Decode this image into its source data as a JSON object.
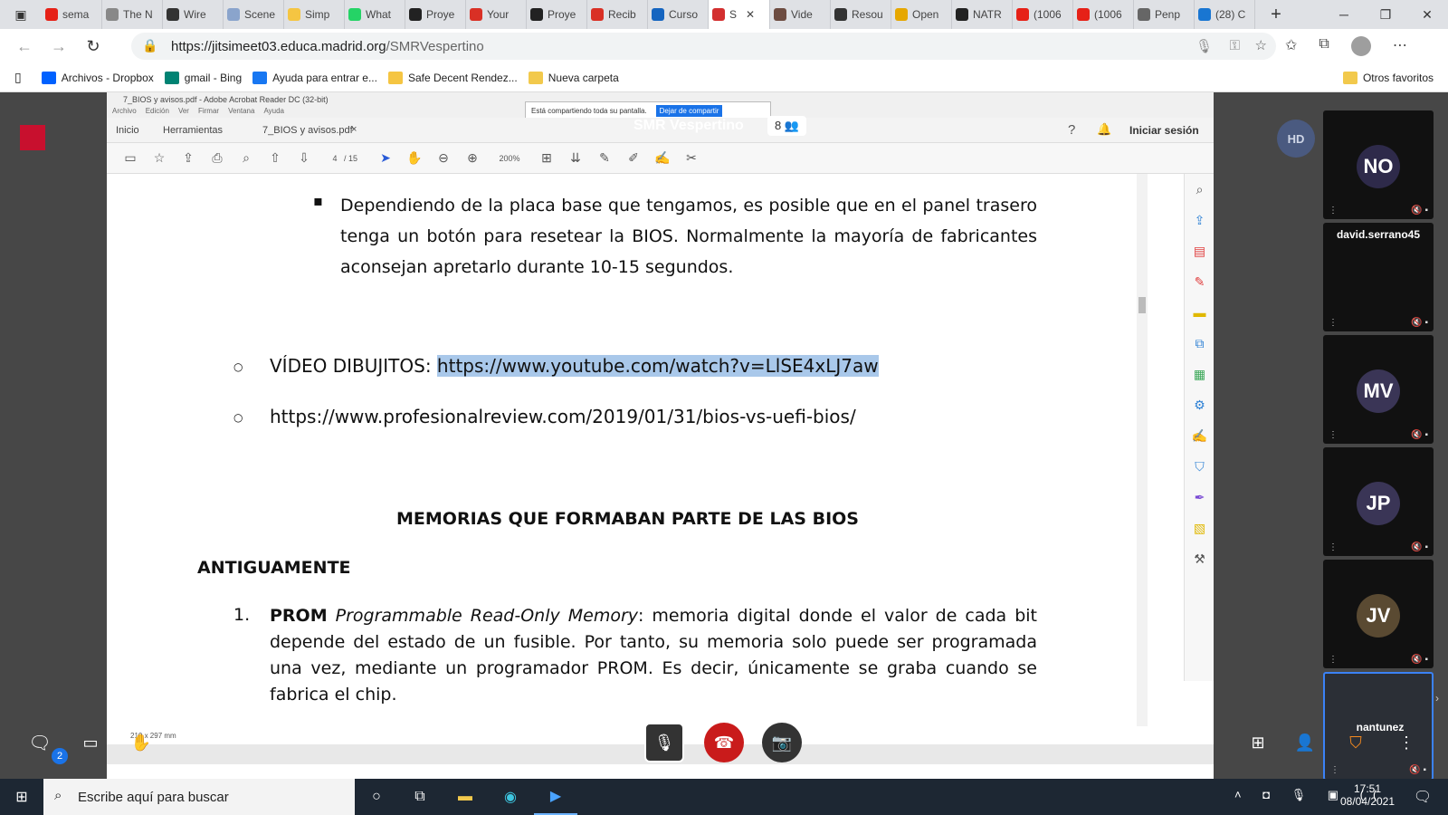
{
  "browser": {
    "tabs": [
      {
        "title": "sema",
        "color": "#e62117"
      },
      {
        "title": "The N",
        "color": "#888888"
      },
      {
        "title": "Wire",
        "color": "#333333"
      },
      {
        "title": "Scene",
        "color": "#8aa4cc"
      },
      {
        "title": "Simp",
        "color": "#f5c542"
      },
      {
        "title": "What",
        "color": "#25d366"
      },
      {
        "title": "Proye",
        "color": "#222222"
      },
      {
        "title": "Your",
        "color": "#d93025"
      },
      {
        "title": "Proye",
        "color": "#222222"
      },
      {
        "title": "Recib",
        "color": "#d93025"
      },
      {
        "title": "Curso",
        "color": "#1565c0"
      },
      {
        "title": "S",
        "color": "#d32f2f",
        "active": true
      },
      {
        "title": "Vide",
        "color": "#6d4c41"
      },
      {
        "title": "Resou",
        "color": "#333333"
      },
      {
        "title": "Open",
        "color": "#e6a700"
      },
      {
        "title": "NATR",
        "color": "#222222"
      },
      {
        "title": "(1006",
        "color": "#e62117"
      },
      {
        "title": "(1006",
        "color": "#e62117"
      },
      {
        "title": "Penp",
        "color": "#666666"
      },
      {
        "title": "(28) C",
        "color": "#1976d2"
      }
    ],
    "url_host": "https://jitsimeet03.educa.madrid.org",
    "url_path": "/SMRVespertino",
    "bookmarks": [
      {
        "label": "Archivos - Dropbox",
        "color": "#0061ff"
      },
      {
        "label": "gmail - Bing",
        "color": "#008373"
      },
      {
        "label": "Ayuda para entrar e...",
        "color": "#1877f2"
      },
      {
        "label": "Safe Decent Rendez...",
        "color": "#f5c542"
      },
      {
        "label": "Nueva carpeta",
        "color": "#f2c94c"
      }
    ],
    "other_favorites": "Otros favoritos"
  },
  "acrobat": {
    "window_title": "7_BIOS y avisos.pdf - Adobe Acrobat Reader DC (32-bit)",
    "menu": [
      "Archivo",
      "Edición",
      "Ver",
      "Firmar",
      "Ventana",
      "Ayuda"
    ],
    "tabs": [
      "Inicio",
      "Herramientas",
      "7_BIOS y avisos.pdf"
    ],
    "page_current": "4",
    "page_total": "/ 15",
    "zoom": "200%",
    "page_size": "210 x 297 mm",
    "share_notice": "Está compartiendo toda su pantalla.",
    "share_stop": "Dejar de compartir"
  },
  "document": {
    "bullet_text": "Dependiendo de la placa base que tengamos, es posible que en el panel trasero tenga un botón para resetear la BIOS. Normalmente la mayoría de fabricantes aconsejan apretarlo durante 10-15 segundos.",
    "video_label": "VÍDEO DIBUJITOS: ",
    "video_link": "https://www.youtube.com/watch?v=LlSE4xLJ7aw",
    "second_link": "https://www.profesionalreview.com/2019/01/31/bios-vs-uefi-bios/",
    "heading": "MEMORIAS QUE FORMABAN PARTE DE LAS BIOS",
    "subheading": "ANTIGUAMENTE",
    "item_num": "1.",
    "item_bold": "PROM",
    "item_italic": "Programmable Read-Only Memory",
    "item_text": ": memoria digital donde el valor de cada bit depende del estado de un fusible. Por tanto, su memoria solo puede ser programada una vez, mediante un programador PROM. Es decir, únicamente se graba cuando se fabrica el chip."
  },
  "meeting": {
    "room_name": "SMR Vespertino",
    "participant_count": "8",
    "sign_in": "Iniciar sesión",
    "self_initials": "HD",
    "chat_badge": "2",
    "participants": [
      {
        "initials": "NO",
        "name": "",
        "color": "#2e2a4a"
      },
      {
        "initials": "",
        "name": "david.serrano45",
        "color": "#2e2a4a"
      },
      {
        "initials": "MV",
        "name": "",
        "color": "#3a3556"
      },
      {
        "initials": "JP",
        "name": "",
        "color": "#3a3556"
      },
      {
        "initials": "JV",
        "name": "",
        "color": "#5a4a32"
      },
      {
        "initials": "",
        "name": "nantunez",
        "color": "#1f2a36"
      }
    ]
  },
  "taskbar": {
    "search_placeholder": "Escribe aquí para buscar",
    "time": "17:51",
    "date": "08/04/2021"
  }
}
